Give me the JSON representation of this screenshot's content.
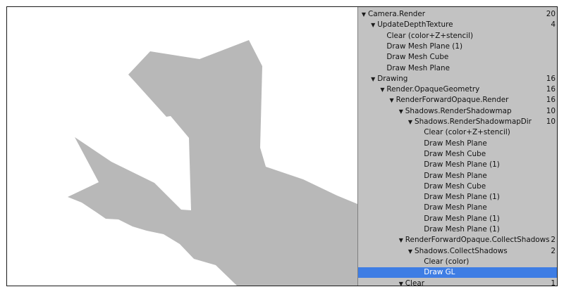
{
  "scene": {
    "viewport_bg": "#ffffff",
    "shadow_color": "#b8b8b8"
  },
  "frame_debugger": {
    "bg_color": "#c2c2c2",
    "selected_color": "#3e7de4",
    "events": [
      {
        "label": "Camera.Render",
        "count": "20",
        "depth": 0,
        "expandable": true
      },
      {
        "label": "UpdateDepthTexture",
        "count": "4",
        "depth": 1,
        "expandable": true
      },
      {
        "label": "Clear (color+Z+stencil)",
        "count": "",
        "depth": 2,
        "expandable": false
      },
      {
        "label": "Draw Mesh Plane (1)",
        "count": "",
        "depth": 2,
        "expandable": false
      },
      {
        "label": "Draw Mesh Cube",
        "count": "",
        "depth": 2,
        "expandable": false
      },
      {
        "label": "Draw Mesh Plane",
        "count": "",
        "depth": 2,
        "expandable": false
      },
      {
        "label": "Drawing",
        "count": "16",
        "depth": 1,
        "expandable": true
      },
      {
        "label": "Render.OpaqueGeometry",
        "count": "16",
        "depth": 2,
        "expandable": true
      },
      {
        "label": "RenderForwardOpaque.Render",
        "count": "16",
        "depth": 3,
        "expandable": true
      },
      {
        "label": "Shadows.RenderShadowmap",
        "count": "10",
        "depth": 4,
        "expandable": true
      },
      {
        "label": "Shadows.RenderShadowmapDir",
        "count": "10",
        "depth": 5,
        "expandable": true
      },
      {
        "label": "Clear (color+Z+stencil)",
        "count": "",
        "depth": 6,
        "expandable": false
      },
      {
        "label": "Draw Mesh Plane",
        "count": "",
        "depth": 6,
        "expandable": false
      },
      {
        "label": "Draw Mesh Cube",
        "count": "",
        "depth": 6,
        "expandable": false
      },
      {
        "label": "Draw Mesh Plane (1)",
        "count": "",
        "depth": 6,
        "expandable": false
      },
      {
        "label": "Draw Mesh Plane",
        "count": "",
        "depth": 6,
        "expandable": false
      },
      {
        "label": "Draw Mesh Cube",
        "count": "",
        "depth": 6,
        "expandable": false
      },
      {
        "label": "Draw Mesh Plane (1)",
        "count": "",
        "depth": 6,
        "expandable": false
      },
      {
        "label": "Draw Mesh Plane",
        "count": "",
        "depth": 6,
        "expandable": false
      },
      {
        "label": "Draw Mesh Plane (1)",
        "count": "",
        "depth": 6,
        "expandable": false
      },
      {
        "label": "Draw Mesh Plane (1)",
        "count": "",
        "depth": 6,
        "expandable": false
      },
      {
        "label": "RenderForwardOpaque.CollectShadows",
        "count": "2",
        "depth": 4,
        "expandable": true
      },
      {
        "label": "Shadows.CollectShadows",
        "count": "2",
        "depth": 5,
        "expandable": true
      },
      {
        "label": "Clear (color)",
        "count": "",
        "depth": 6,
        "expandable": false
      },
      {
        "label": "Draw GL",
        "count": "",
        "depth": 6,
        "expandable": false,
        "selected": true
      },
      {
        "label": "Clear",
        "count": "1",
        "depth": 4,
        "expandable": true
      }
    ]
  }
}
